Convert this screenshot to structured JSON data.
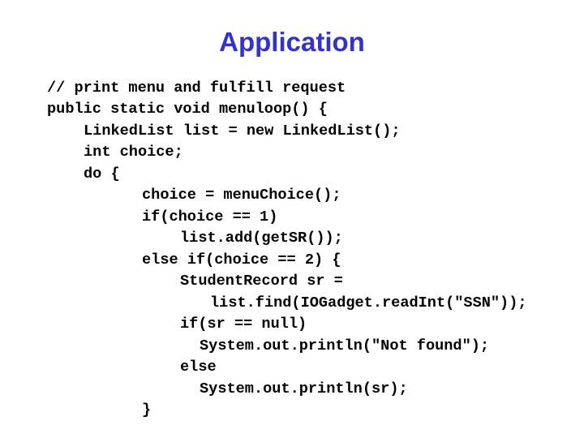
{
  "slide": {
    "title": "Application",
    "title_color": "#3333cc",
    "code_lines": [
      "// print menu and fulfill request",
      "public static void menuloop() {",
      "LinkedList list = new LinkedList();",
      "int choice;",
      "do {",
      "choice = menuChoice();",
      "if(choice == 1)",
      "list.add(getSR());",
      "else if(choice == 2) {",
      "StudentRecord sr =",
      "list.find(IOGadget.readInt(\"SSN\"));",
      "if(sr == null)",
      "System.out.println(\"Not found\");",
      "else",
      "System.out.println(sr);",
      "}"
    ]
  }
}
